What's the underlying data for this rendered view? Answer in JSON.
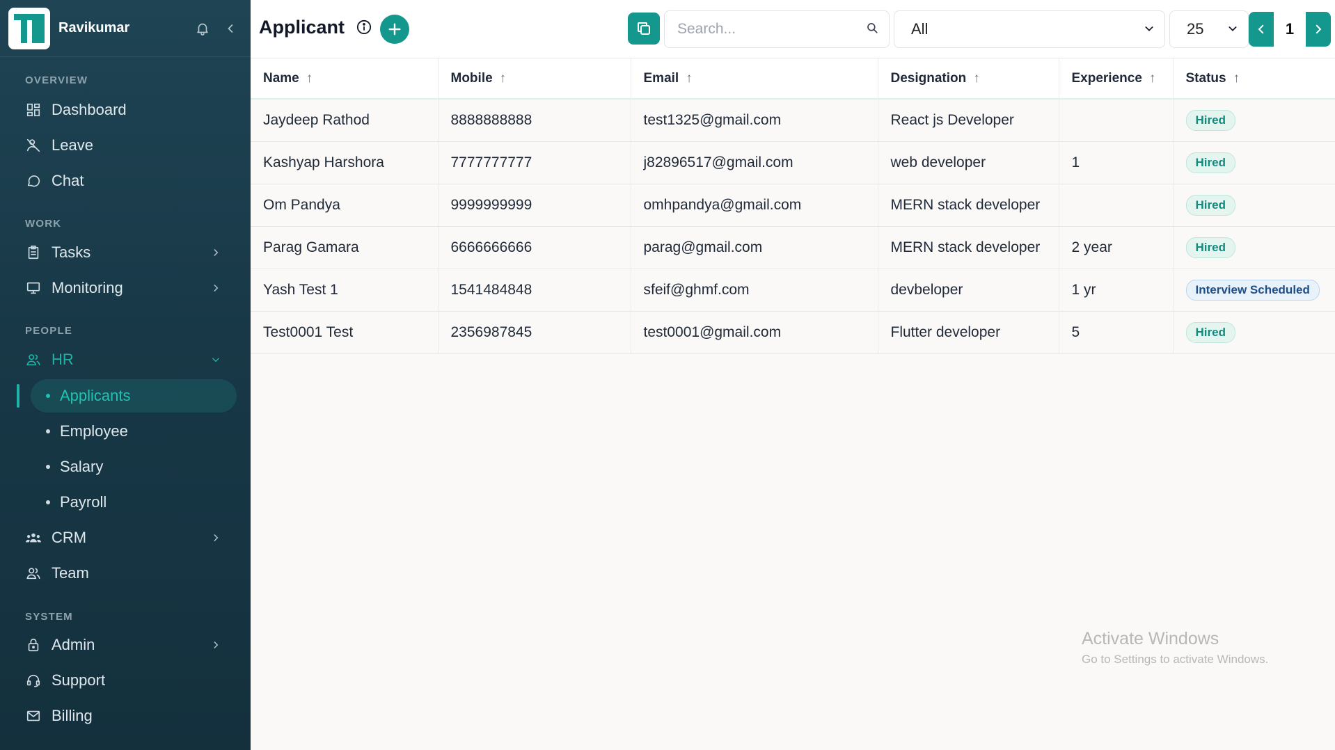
{
  "user": {
    "name": "Ravikumar"
  },
  "sidebar": {
    "sections": {
      "overview": "OVERVIEW",
      "work": "WORK",
      "people": "PEOPLE",
      "system": "SYSTEM"
    },
    "items": {
      "dashboard": "Dashboard",
      "leave": "Leave",
      "chat": "Chat",
      "tasks": "Tasks",
      "monitoring": "Monitoring",
      "hr": "HR",
      "applicants": "Applicants",
      "employee": "Employee",
      "salary": "Salary",
      "payroll": "Payroll",
      "crm": "CRM",
      "team": "Team",
      "admin": "Admin",
      "support": "Support",
      "billing": "Billing"
    },
    "active_item": "Applicants"
  },
  "header": {
    "title": "Applicant",
    "search_placeholder": "Search...",
    "filter_value": "All",
    "page_size": "25",
    "current_page": "1"
  },
  "table": {
    "columns": [
      "Name",
      "Mobile",
      "Email",
      "Designation",
      "Experience",
      "Status"
    ],
    "rows": [
      {
        "name": "Jaydeep Rathod",
        "mobile": "8888888888",
        "email": "test1325@gmail.com",
        "designation": "React js Developer",
        "experience": "",
        "status": "Hired"
      },
      {
        "name": "Kashyap Harshora",
        "mobile": "7777777777",
        "email": "j82896517@gmail.com",
        "designation": "web developer",
        "experience": "1",
        "status": "Hired"
      },
      {
        "name": "Om Pandya",
        "mobile": "9999999999",
        "email": "omhpandya@gmail.com",
        "designation": "MERN stack developer",
        "experience": "",
        "status": "Hired"
      },
      {
        "name": "Parag Gamara",
        "mobile": "6666666666",
        "email": "parag@gmail.com",
        "designation": "MERN stack developer",
        "experience": "2 year",
        "status": "Hired"
      },
      {
        "name": "Yash Test 1",
        "mobile": "1541484848",
        "email": "sfeif@ghmf.com",
        "designation": "devbeloper",
        "experience": "1 yr",
        "status": "Interview Scheduled"
      },
      {
        "name": "Test0001 Test",
        "mobile": "2356987845",
        "email": "test0001@gmail.com",
        "designation": "Flutter developer",
        "experience": "5",
        "status": "Hired"
      }
    ]
  },
  "watermark": {
    "title": "Activate Windows",
    "subtitle": "Go to Settings to activate Windows."
  },
  "colors": {
    "accent": "#14978c",
    "sidebar_bg": "#1a3c4b",
    "active_text": "#22c1b3",
    "hired_badge": "#e4f5f0",
    "interview_badge": "#e8f2fb"
  }
}
